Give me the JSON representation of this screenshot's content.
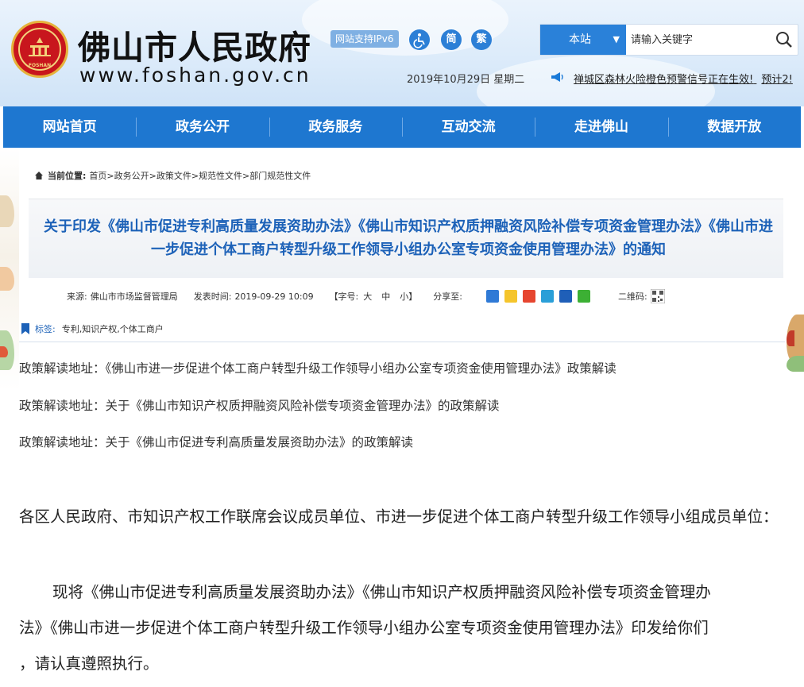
{
  "header": {
    "site_title": "佛山市人民政府",
    "site_url": "www.foshan.gov.cn",
    "emblem_text": "FOSHAN",
    "ipv6_badge": "网站支持IPv6",
    "tool_simplified": "简",
    "tool_traditional": "繁",
    "search": {
      "scope": "本站",
      "placeholder": "请输入关键字"
    },
    "date": "2019年10月29日 星期二",
    "alert": "禅城区森林火险橙色预警信号正在生效!",
    "alert_tail": "预计2!"
  },
  "nav": {
    "items": [
      "网站首页",
      "政务公开",
      "政务服务",
      "互动交流",
      "走进佛山",
      "数据开放"
    ]
  },
  "breadcrumb": {
    "label": "当前位置:",
    "path": "首页>政务公开>政策文件>规范性文件>部门规范性文件"
  },
  "article": {
    "title": "关于印发《佛山市促进专利高质量发展资助办法》《佛山市知识产权质押融资风险补偿专项资金管理办法》《佛山市进一步促进个体工商户转型升级工作领导小组办公室专项资金使用管理办法》的通知",
    "meta": {
      "source_label": "来源:",
      "source": "佛山市市场监督管理局",
      "time_label": "发表时间:",
      "time": "2019-09-29 10:09",
      "font_label": "【字号:",
      "font_large": "大",
      "font_medium": "中",
      "font_small": "小】",
      "share_label": "分享至:",
      "qr_label": "二维码:"
    },
    "tags_label": "标签:",
    "tags": "专利,知识产权,个体工商户",
    "interpretations": [
      "政策解读地址：《佛山市进一步促进个体工商户转型升级工作领导小组办公室专项资金使用管理办法》政策解读",
      "政策解读地址：关于《佛山市知识产权质押融资风险补偿专项资金管理办法》的政策解读",
      "政策解读地址：关于《佛山市促进专利高质量发展资助办法》的政策解读"
    ],
    "body_para1": "各区人民政府、市知识产权工作联席会议成员单位、市进一步促进个体工商户转型升级工作领导小组成员单位：",
    "body_para2_line1": "现将《佛山市促进专利高质量发展资助办法》《佛山市知识产权质押融资风险补偿专项资金管理办",
    "body_para2_line2": "法》《佛山市进一步促进个体工商户转型升级工作领导小组办公室专项资金使用管理办法》印发给你们",
    "body_para2_line3": "，请认真遵照执行。"
  },
  "colors": {
    "nav_blue": "#1e77d0",
    "title_blue": "#1d62b8",
    "emblem_red": "#c8161d"
  }
}
